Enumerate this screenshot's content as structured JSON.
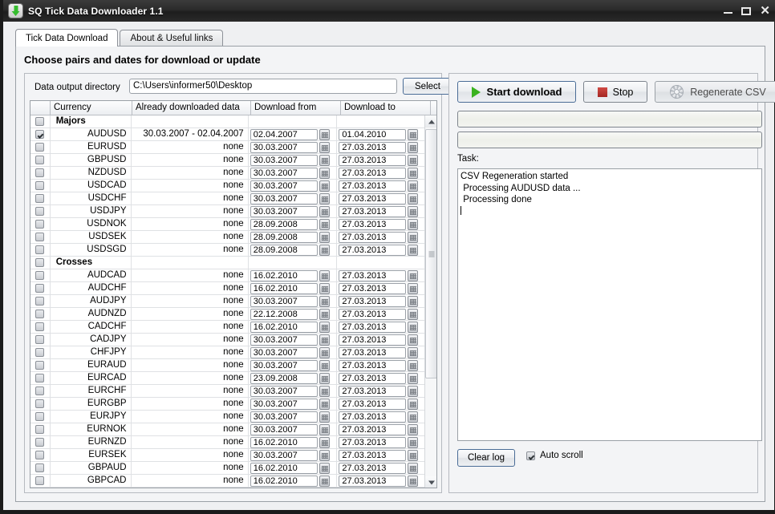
{
  "window": {
    "title": "SQ Tick Data Downloader 1.1",
    "app_icon": "download-arrow-icon",
    "minimize": "–",
    "maximize": "□",
    "close": "✕"
  },
  "tabs": [
    {
      "label": "Tick Data Download",
      "active": true
    },
    {
      "label": "About & Useful links",
      "active": false
    }
  ],
  "panel": {
    "title": "Choose pairs and dates for download or update"
  },
  "directory": {
    "label": "Data output directory",
    "value": "C:\\Users\\informer50\\Desktop",
    "select_label": "Select"
  },
  "grid": {
    "headers": [
      "",
      "Currency",
      "Already downloaded data",
      "Download from",
      "Download to"
    ],
    "rows": [
      {
        "type": "group",
        "checked": false,
        "currency": "Majors",
        "downloaded": "",
        "from": "",
        "to": ""
      },
      {
        "type": "pair",
        "checked": true,
        "currency": "AUDUSD",
        "downloaded": "30.03.2007 - 02.04.2007",
        "from": "02.04.2007",
        "to": "01.04.2010"
      },
      {
        "type": "pair",
        "checked": false,
        "currency": "EURUSD",
        "downloaded": "none",
        "from": "30.03.2007",
        "to": "27.03.2013"
      },
      {
        "type": "pair",
        "checked": false,
        "currency": "GBPUSD",
        "downloaded": "none",
        "from": "30.03.2007",
        "to": "27.03.2013"
      },
      {
        "type": "pair",
        "checked": false,
        "currency": "NZDUSD",
        "downloaded": "none",
        "from": "30.03.2007",
        "to": "27.03.2013"
      },
      {
        "type": "pair",
        "checked": false,
        "currency": "USDCAD",
        "downloaded": "none",
        "from": "30.03.2007",
        "to": "27.03.2013"
      },
      {
        "type": "pair",
        "checked": false,
        "currency": "USDCHF",
        "downloaded": "none",
        "from": "30.03.2007",
        "to": "27.03.2013"
      },
      {
        "type": "pair",
        "checked": false,
        "currency": "USDJPY",
        "downloaded": "none",
        "from": "30.03.2007",
        "to": "27.03.2013"
      },
      {
        "type": "pair",
        "checked": false,
        "currency": "USDNOK",
        "downloaded": "none",
        "from": "28.09.2008",
        "to": "27.03.2013"
      },
      {
        "type": "pair",
        "checked": false,
        "currency": "USDSEK",
        "downloaded": "none",
        "from": "28.09.2008",
        "to": "27.03.2013"
      },
      {
        "type": "pair",
        "checked": false,
        "currency": "USDSGD",
        "downloaded": "none",
        "from": "28.09.2008",
        "to": "27.03.2013"
      },
      {
        "type": "group",
        "checked": false,
        "currency": "Crosses",
        "downloaded": "",
        "from": "",
        "to": ""
      },
      {
        "type": "pair",
        "checked": false,
        "currency": "AUDCAD",
        "downloaded": "none",
        "from": "16.02.2010",
        "to": "27.03.2013"
      },
      {
        "type": "pair",
        "checked": false,
        "currency": "AUDCHF",
        "downloaded": "none",
        "from": "16.02.2010",
        "to": "27.03.2013"
      },
      {
        "type": "pair",
        "checked": false,
        "currency": "AUDJPY",
        "downloaded": "none",
        "from": "30.03.2007",
        "to": "27.03.2013"
      },
      {
        "type": "pair",
        "checked": false,
        "currency": "AUDNZD",
        "downloaded": "none",
        "from": "22.12.2008",
        "to": "27.03.2013"
      },
      {
        "type": "pair",
        "checked": false,
        "currency": "CADCHF",
        "downloaded": "none",
        "from": "16.02.2010",
        "to": "27.03.2013"
      },
      {
        "type": "pair",
        "checked": false,
        "currency": "CADJPY",
        "downloaded": "none",
        "from": "30.03.2007",
        "to": "27.03.2013"
      },
      {
        "type": "pair",
        "checked": false,
        "currency": "CHFJPY",
        "downloaded": "none",
        "from": "30.03.2007",
        "to": "27.03.2013"
      },
      {
        "type": "pair",
        "checked": false,
        "currency": "EURAUD",
        "downloaded": "none",
        "from": "30.03.2007",
        "to": "27.03.2013"
      },
      {
        "type": "pair",
        "checked": false,
        "currency": "EURCAD",
        "downloaded": "none",
        "from": "23.09.2008",
        "to": "27.03.2013"
      },
      {
        "type": "pair",
        "checked": false,
        "currency": "EURCHF",
        "downloaded": "none",
        "from": "30.03.2007",
        "to": "27.03.2013"
      },
      {
        "type": "pair",
        "checked": false,
        "currency": "EURGBP",
        "downloaded": "none",
        "from": "30.03.2007",
        "to": "27.03.2013"
      },
      {
        "type": "pair",
        "checked": false,
        "currency": "EURJPY",
        "downloaded": "none",
        "from": "30.03.2007",
        "to": "27.03.2013"
      },
      {
        "type": "pair",
        "checked": false,
        "currency": "EURNOK",
        "downloaded": "none",
        "from": "30.03.2007",
        "to": "27.03.2013"
      },
      {
        "type": "pair",
        "checked": false,
        "currency": "EURNZD",
        "downloaded": "none",
        "from": "16.02.2010",
        "to": "27.03.2013"
      },
      {
        "type": "pair",
        "checked": false,
        "currency": "EURSEK",
        "downloaded": "none",
        "from": "30.03.2007",
        "to": "27.03.2013"
      },
      {
        "type": "pair",
        "checked": false,
        "currency": "GBPAUD",
        "downloaded": "none",
        "from": "16.02.2010",
        "to": "27.03.2013"
      },
      {
        "type": "pair",
        "checked": false,
        "currency": "GBPCAD",
        "downloaded": "none",
        "from": "16.02.2010",
        "to": "27.03.2013"
      }
    ]
  },
  "actions": {
    "start_label": "Start download",
    "stop_label": "Stop",
    "regenerate_label": "Regenerate CSV"
  },
  "progress": {
    "bar_one_percent": 0,
    "bar_two_percent": 0
  },
  "task": {
    "label": "Task:",
    "log": "CSV Regeneration started\n Processing AUDUSD data ...\n Processing done\n"
  },
  "footer": {
    "clear_label": "Clear log",
    "autoscroll_label": "Auto scroll",
    "autoscroll_checked": true
  }
}
